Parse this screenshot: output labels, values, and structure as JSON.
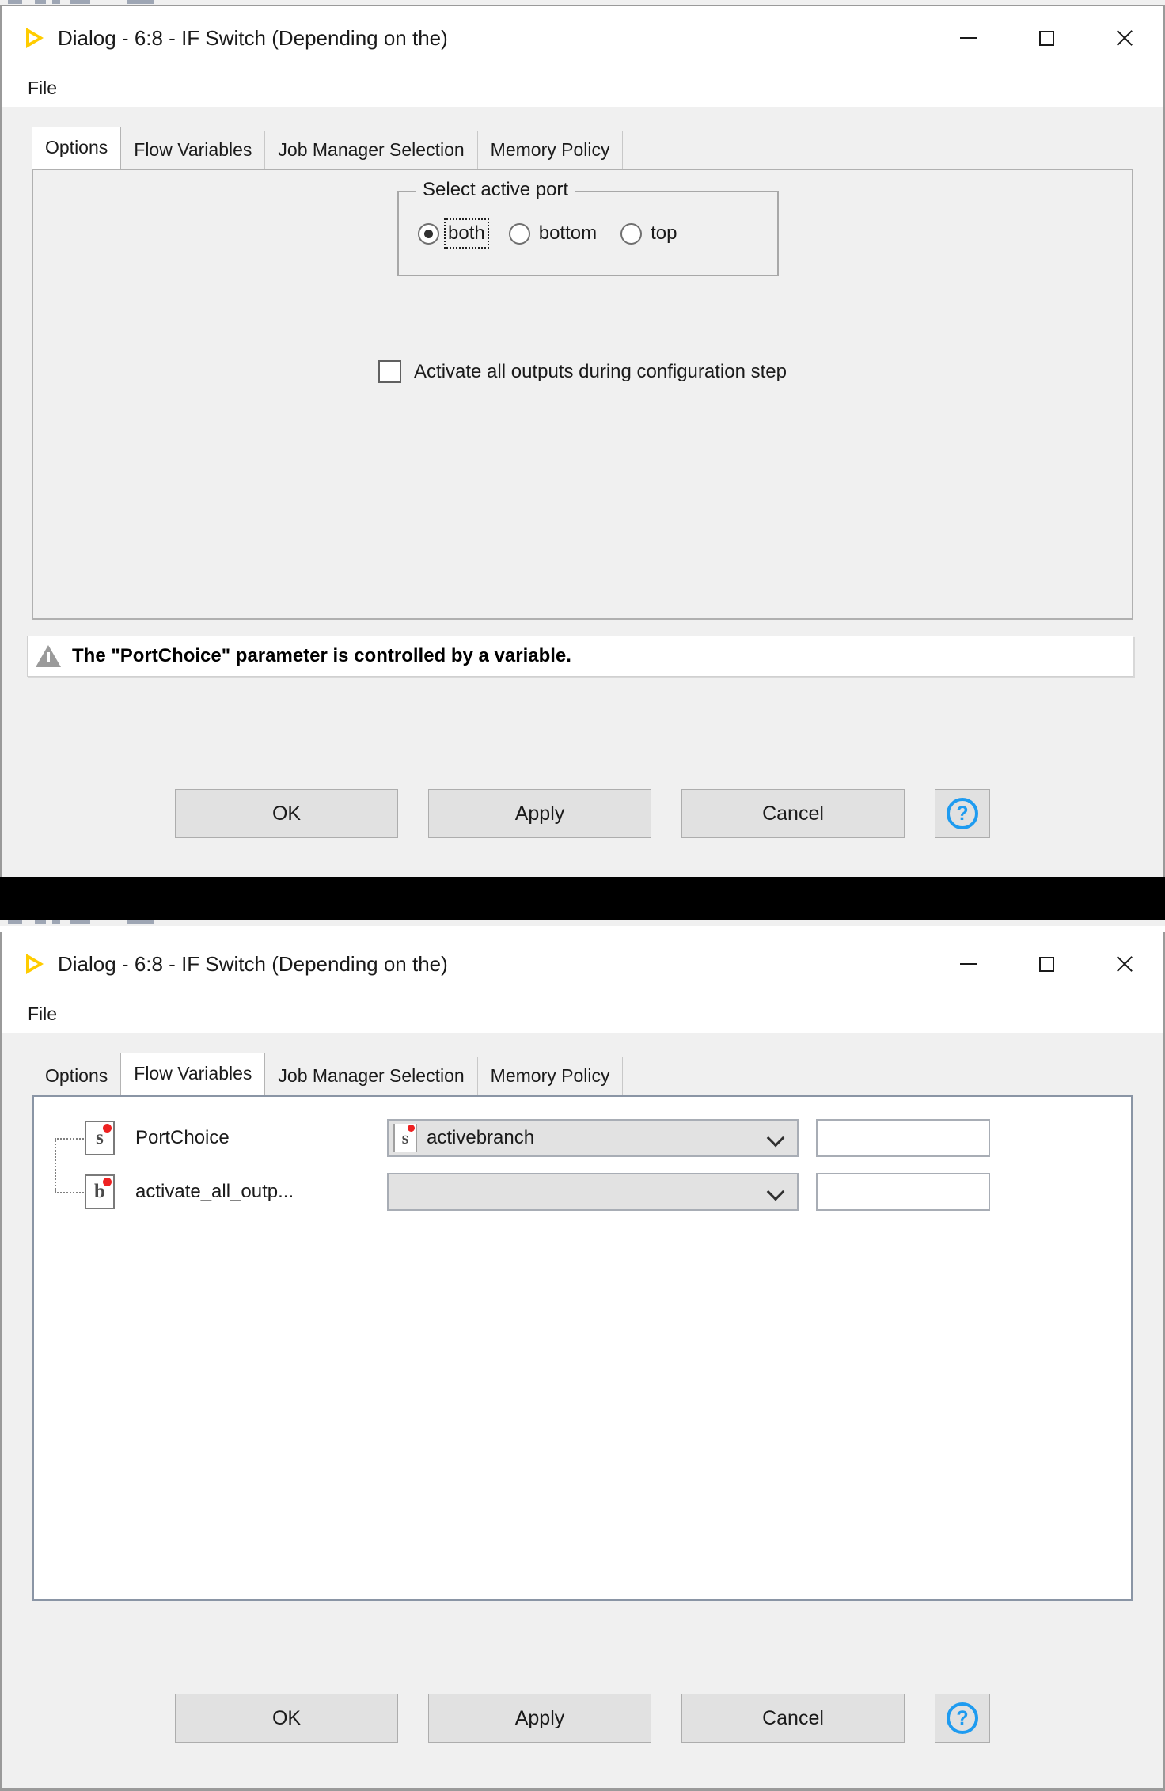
{
  "window": {
    "title": "Dialog - 6:8 - IF Switch (Depending on the)",
    "app_icon": "knime-triangle-icon",
    "controls": {
      "minimize": "minimize-icon",
      "maximize": "maximize-icon",
      "close": "close-icon"
    },
    "menu": {
      "file": "File"
    }
  },
  "tabs": [
    {
      "label": "Options"
    },
    {
      "label": "Flow Variables"
    },
    {
      "label": "Job Manager Selection"
    },
    {
      "label": "Memory Policy"
    }
  ],
  "dialog1": {
    "active_tab": "Options",
    "group": {
      "title": "Select active port",
      "options": [
        {
          "label": "both",
          "checked": true,
          "focused": true
        },
        {
          "label": "bottom",
          "checked": false,
          "focused": false
        },
        {
          "label": "top",
          "checked": false,
          "focused": false
        }
      ]
    },
    "checkbox": {
      "label": "Activate all outputs during configuration step",
      "checked": false
    },
    "warning": {
      "icon": "warning-triangle-icon",
      "text": "The \"PortChoice\" parameter is controlled by a variable."
    }
  },
  "dialog2": {
    "active_tab": "Flow Variables",
    "rows": [
      {
        "type_icon": "s",
        "name": "PortChoice",
        "combo_value": "activebranch",
        "combo_icon": "s",
        "combo_enabled": true,
        "textfield_value": ""
      },
      {
        "type_icon": "b",
        "name": "activate_all_outp...",
        "combo_value": "",
        "combo_icon": "",
        "combo_enabled": false,
        "textfield_value": ""
      }
    ]
  },
  "buttons": {
    "ok": "OK",
    "apply": "Apply",
    "cancel": "Cancel",
    "help": "?"
  },
  "colors": {
    "accent_yellow": "#ffcc00",
    "help_blue": "#1e9bf0",
    "variable_dot_red": "#ee2222",
    "panel_bg": "#f0f0f0",
    "content_bg": "#ffffff"
  }
}
